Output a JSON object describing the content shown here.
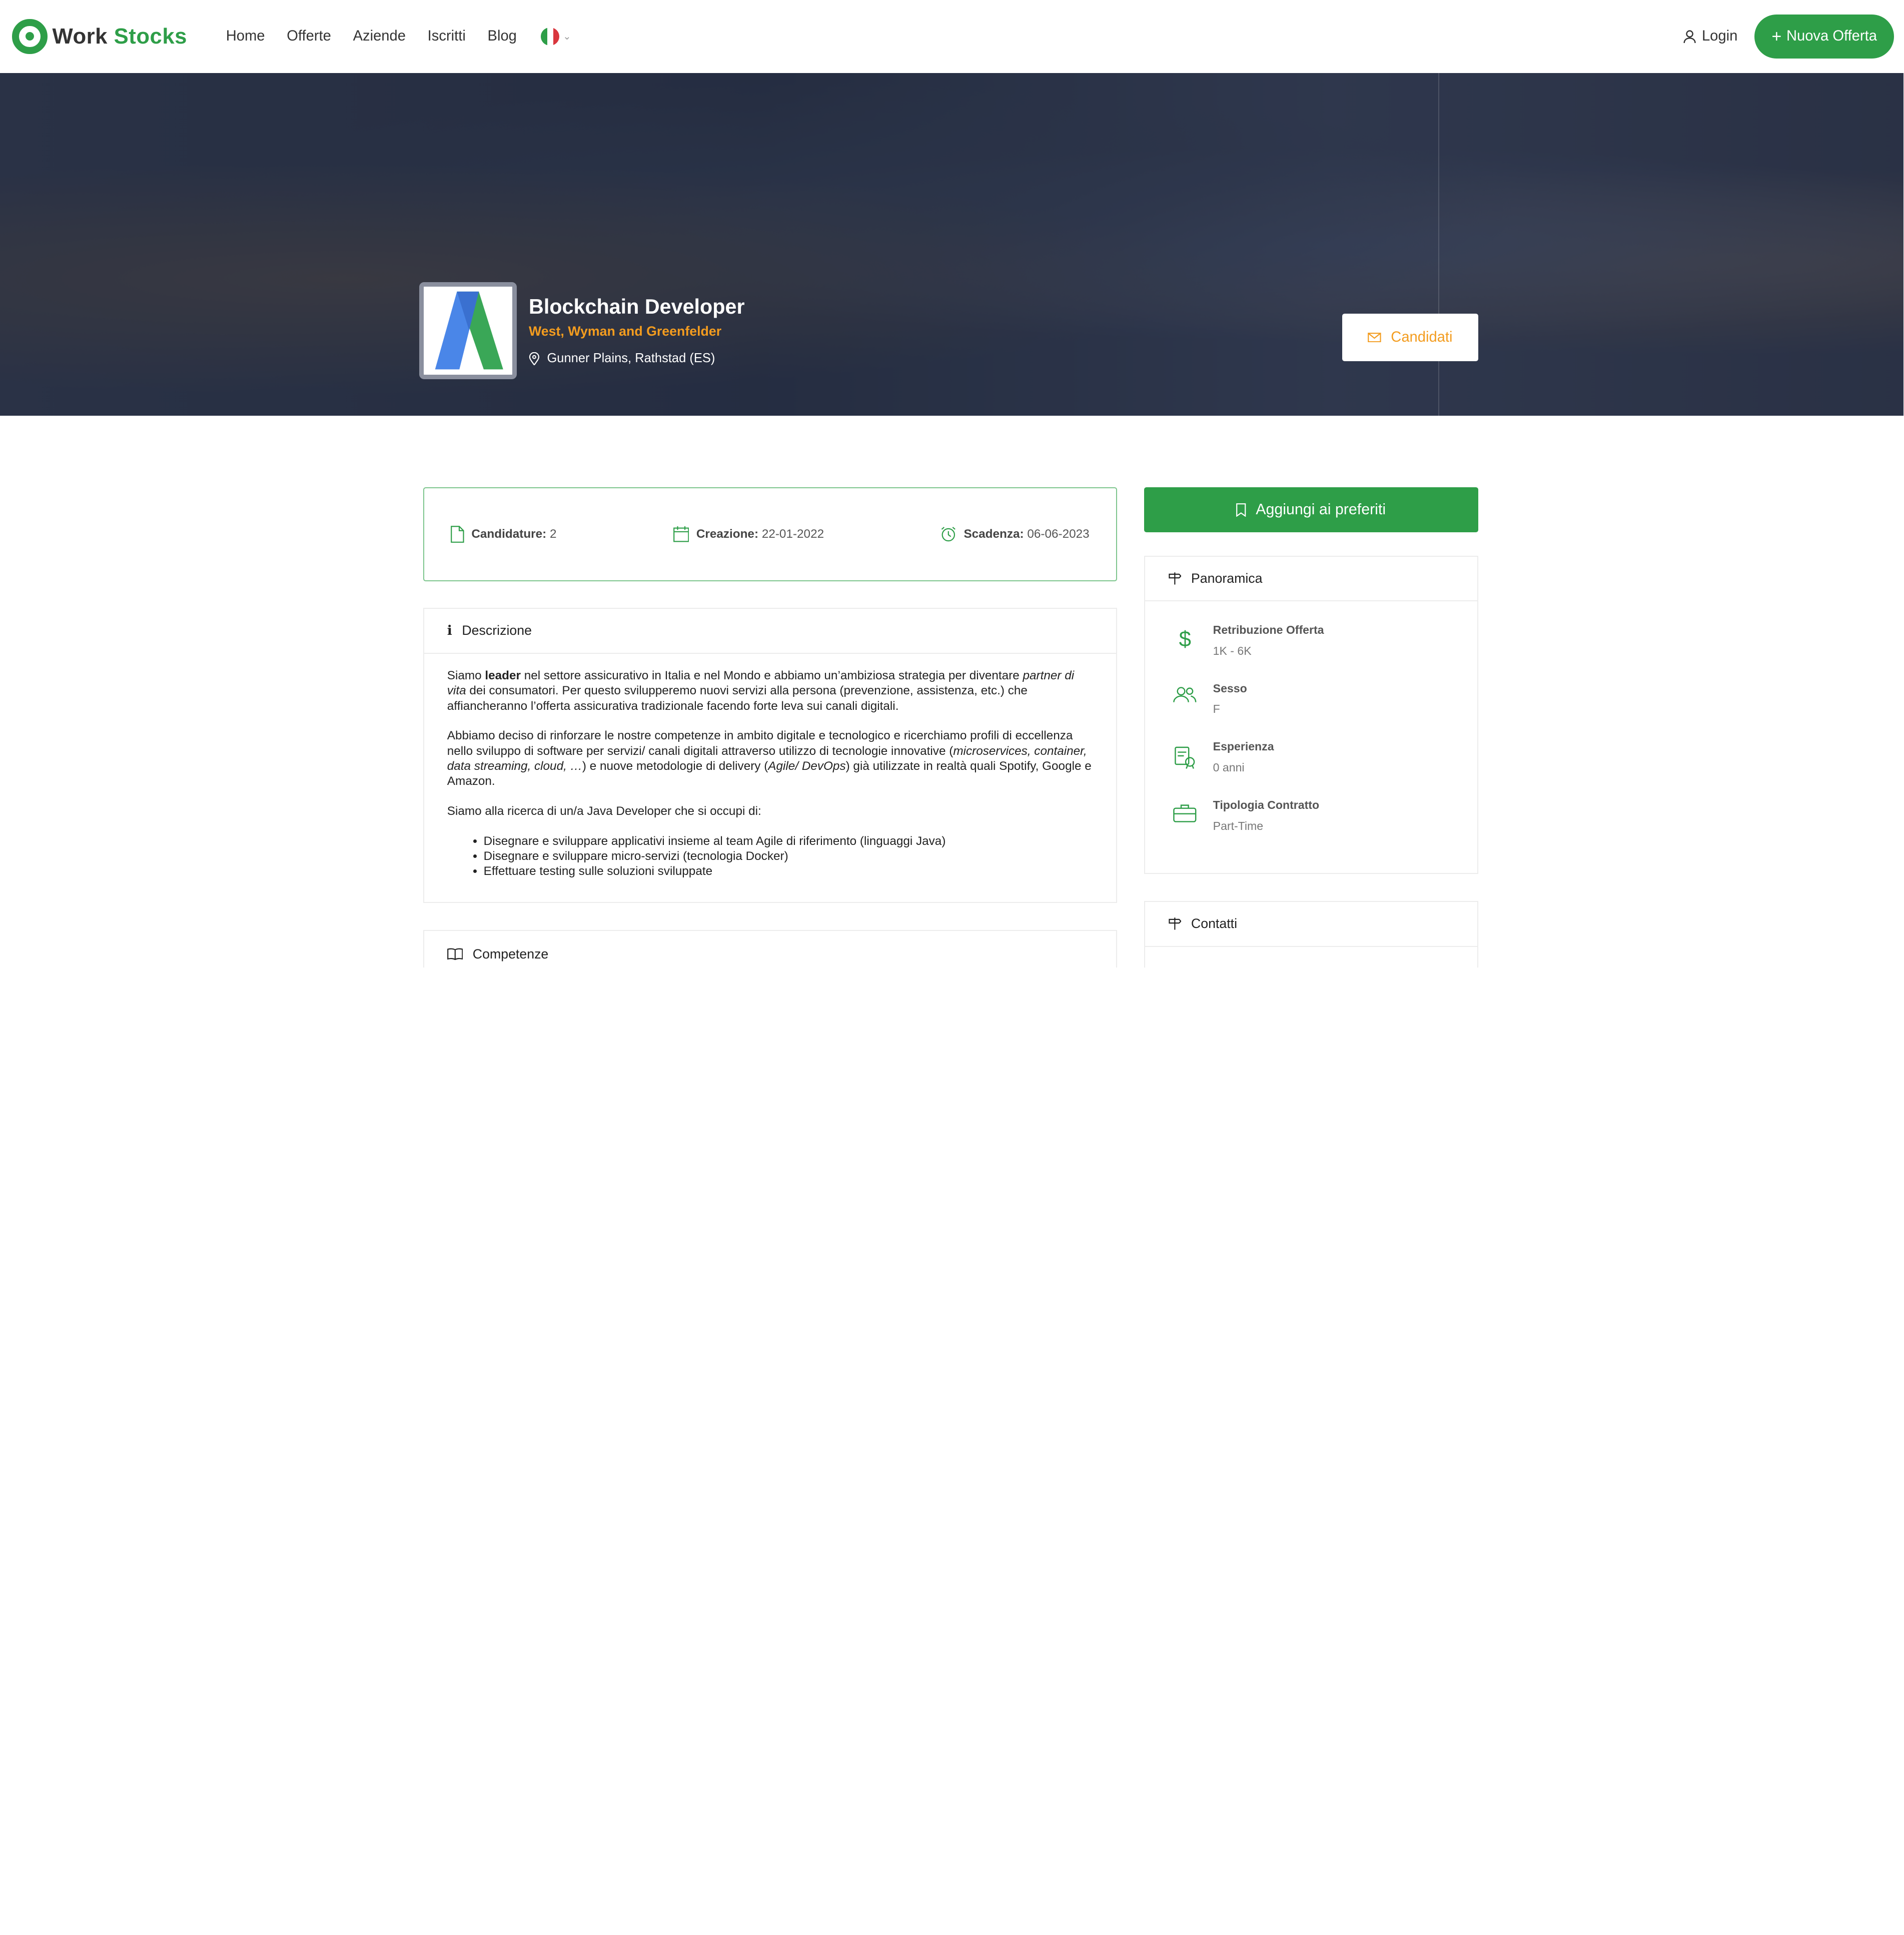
{
  "nav": {
    "logo_word1": "Work",
    "logo_word2": "Stocks",
    "links": [
      "Home",
      "Offerte",
      "Aziende",
      "Iscritti",
      "Blog"
    ],
    "language_flag": "italy-flag",
    "login_label": "Login",
    "new_offer_label": "Nuova Offerta"
  },
  "hero": {
    "job_title": "Blockchain Developer",
    "company": "West, Wyman and Greenfelder",
    "location": "Gunner Plains, Rathstad (ES)",
    "apply_label": "Candidati"
  },
  "stats": {
    "applications_label": "Candidature:",
    "applications_value": "2",
    "created_label": "Creazione:",
    "created_value": "22-01-2022",
    "deadline_label": "Scadenza:",
    "deadline_value": "06-06-2023"
  },
  "description": {
    "heading": "Descrizione",
    "p1_a": "Siamo ",
    "p1_bold": "leader",
    "p1_b": " nel settore assicurativo in Italia e nel Mondo e abbiamo un’ambiziosa strategia per diventare ",
    "p1_italic": "partner di vita",
    "p1_c": " dei consumatori. Per questo svilupperemo nuovi servizi alla persona (prevenzione, assistenza, etc.) che affiancheranno l’offerta assicurativa tradizionale facendo forte leva sui canali digitali.",
    "p2_a": "Abbiamo deciso di rinforzare le nostre competenze in ambito digitale e tecnologico e ricerchiamo profili di eccellenza nello sviluppo di software per servizi/ canali digitali attraverso utilizzo di tecnologie innovative (",
    "p2_italic1": "microservices, container, data streaming, cloud, …",
    "p2_b": ") e nuove metodologie di delivery (",
    "p2_italic2": "Agile/ DevOps",
    "p2_c": ") già utilizzate in realtà quali Spotify, Google e Amazon.",
    "p3": "Siamo alla ricerca di un/a Java Developer che si occupi di:",
    "bullets": [
      "Disegnare e sviluppare applicativi insieme al team Agile di riferimento (linguaggi Java)",
      "Disegnare e sviluppare micro-servizi (tecnologia Docker)",
      "Effettuare testing sulle soluzioni sviluppate"
    ]
  },
  "skills": {
    "heading": "Competenze"
  },
  "sidebar": {
    "favorite_label": "Aggiungi ai preferiti",
    "overview_heading": "Panoramica",
    "overview": [
      {
        "label": "Retribuzione Offerta",
        "value": "1K - 6K",
        "icon": "dollar-icon"
      },
      {
        "label": "Sesso",
        "value": "F",
        "icon": "users-icon"
      },
      {
        "label": "Esperienza",
        "value": "0 anni",
        "icon": "experience-icon"
      },
      {
        "label": "Tipologia Contratto",
        "value": "Part-Time",
        "icon": "briefcase-icon"
      }
    ],
    "contacts_heading": "Contatti"
  },
  "colors": {
    "brand_green": "#2e9e48",
    "accent_orange": "#f39c1f"
  }
}
